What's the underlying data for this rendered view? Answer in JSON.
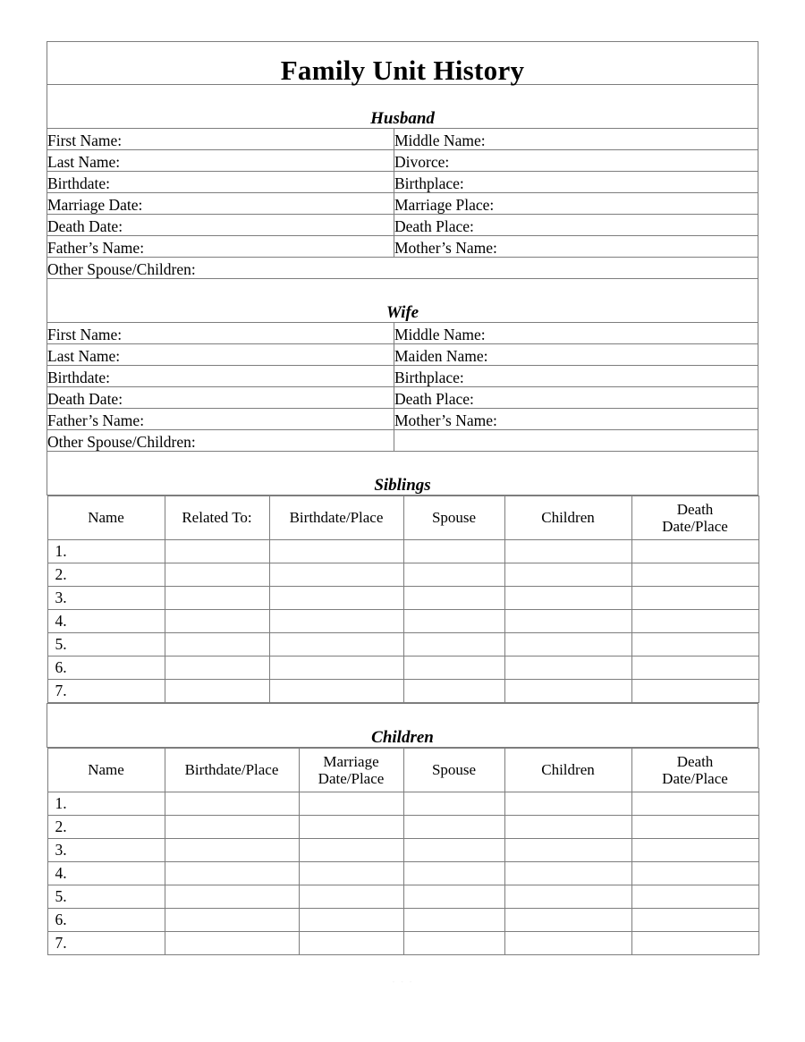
{
  "document": {
    "title": "Family Unit History",
    "footer_note": "· · ·"
  },
  "husband": {
    "heading": "Husband",
    "rows": [
      {
        "left": "First Name:",
        "right": "Middle Name:"
      },
      {
        "left": "Last Name:",
        "right": "Divorce:"
      },
      {
        "left": "Birthdate:",
        "right": "Birthplace:"
      },
      {
        "left": "Marriage Date:",
        "right": "Marriage Place:"
      },
      {
        "left": "Death Date:",
        "right": "Death Place:"
      },
      {
        "left": "Father’s Name:",
        "right": "Mother’s Name:"
      }
    ],
    "other": "Other Spouse/Children:"
  },
  "wife": {
    "heading": "Wife",
    "rows": [
      {
        "left": "First Name:",
        "right": "Middle Name:"
      },
      {
        "left": "Last Name:",
        "right": "Maiden Name:"
      },
      {
        "left": "Birthdate:",
        "right": "Birthplace:"
      },
      {
        "left": "Death Date:",
        "right": "Death Place:"
      },
      {
        "left": "Father’s Name:",
        "right": "Mother’s Name:"
      }
    ],
    "other": "Other Spouse/Children:",
    "other_right": ""
  },
  "siblings": {
    "heading": "Siblings",
    "columns": [
      "Name",
      "Related To:",
      "Birthdate/Place",
      "Spouse",
      "Children",
      "Death\nDate/Place"
    ],
    "row_numbers": [
      "1.",
      "2.",
      "3.",
      "4.",
      "5.",
      "6.",
      "7."
    ]
  },
  "children": {
    "heading": "Children",
    "columns": [
      "Name",
      "Birthdate/Place",
      "Marriage\nDate/Place",
      "Spouse",
      "Children",
      "Death\nDate/Place"
    ],
    "row_numbers": [
      "1.",
      "2.",
      "3.",
      "4.",
      "5.",
      "6.",
      "7."
    ]
  },
  "colors": {
    "border": "#7d7d7d",
    "text": "#000000",
    "background": "#ffffff"
  }
}
